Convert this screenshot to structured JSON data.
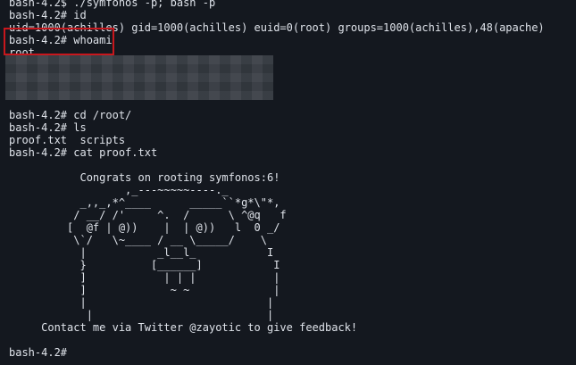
{
  "terminal": {
    "lines": [
      "bash-4.2$ ./symfonos -p; bash -p",
      "bash-4.2# id",
      "uid=1000(achilles) gid=1000(achilles) euid=0(root) groups=1000(achilles),48(apache)",
      "bash-4.2# whoami",
      "root",
      "",
      "",
      "",
      "",
      "bash-4.2# cd /root/",
      "bash-4.2# ls",
      "proof.txt  scripts",
      "bash-4.2# cat proof.txt",
      "",
      "           Congrats on rooting symfonos:6!",
      "                  ,_---~~~~~----._",
      "           _,,_,*^____      _____``*g*\\\"*,",
      "          / __/ /'     ^.  /      \\ ^@q   f",
      "         [  @f | @))    |  | @))   l  0 _/",
      "          \\`/   \\~____ / __ \\_____/    \\",
      "           |           _l__l_           I",
      "           }          [______]           I",
      "           ]            | | |            |",
      "           ]             ~ ~             |",
      "           |                            |",
      "            |                           |",
      "     Contact me via Twitter @zayotic to give feedback!",
      "",
      "bash-4.2#"
    ]
  }
}
